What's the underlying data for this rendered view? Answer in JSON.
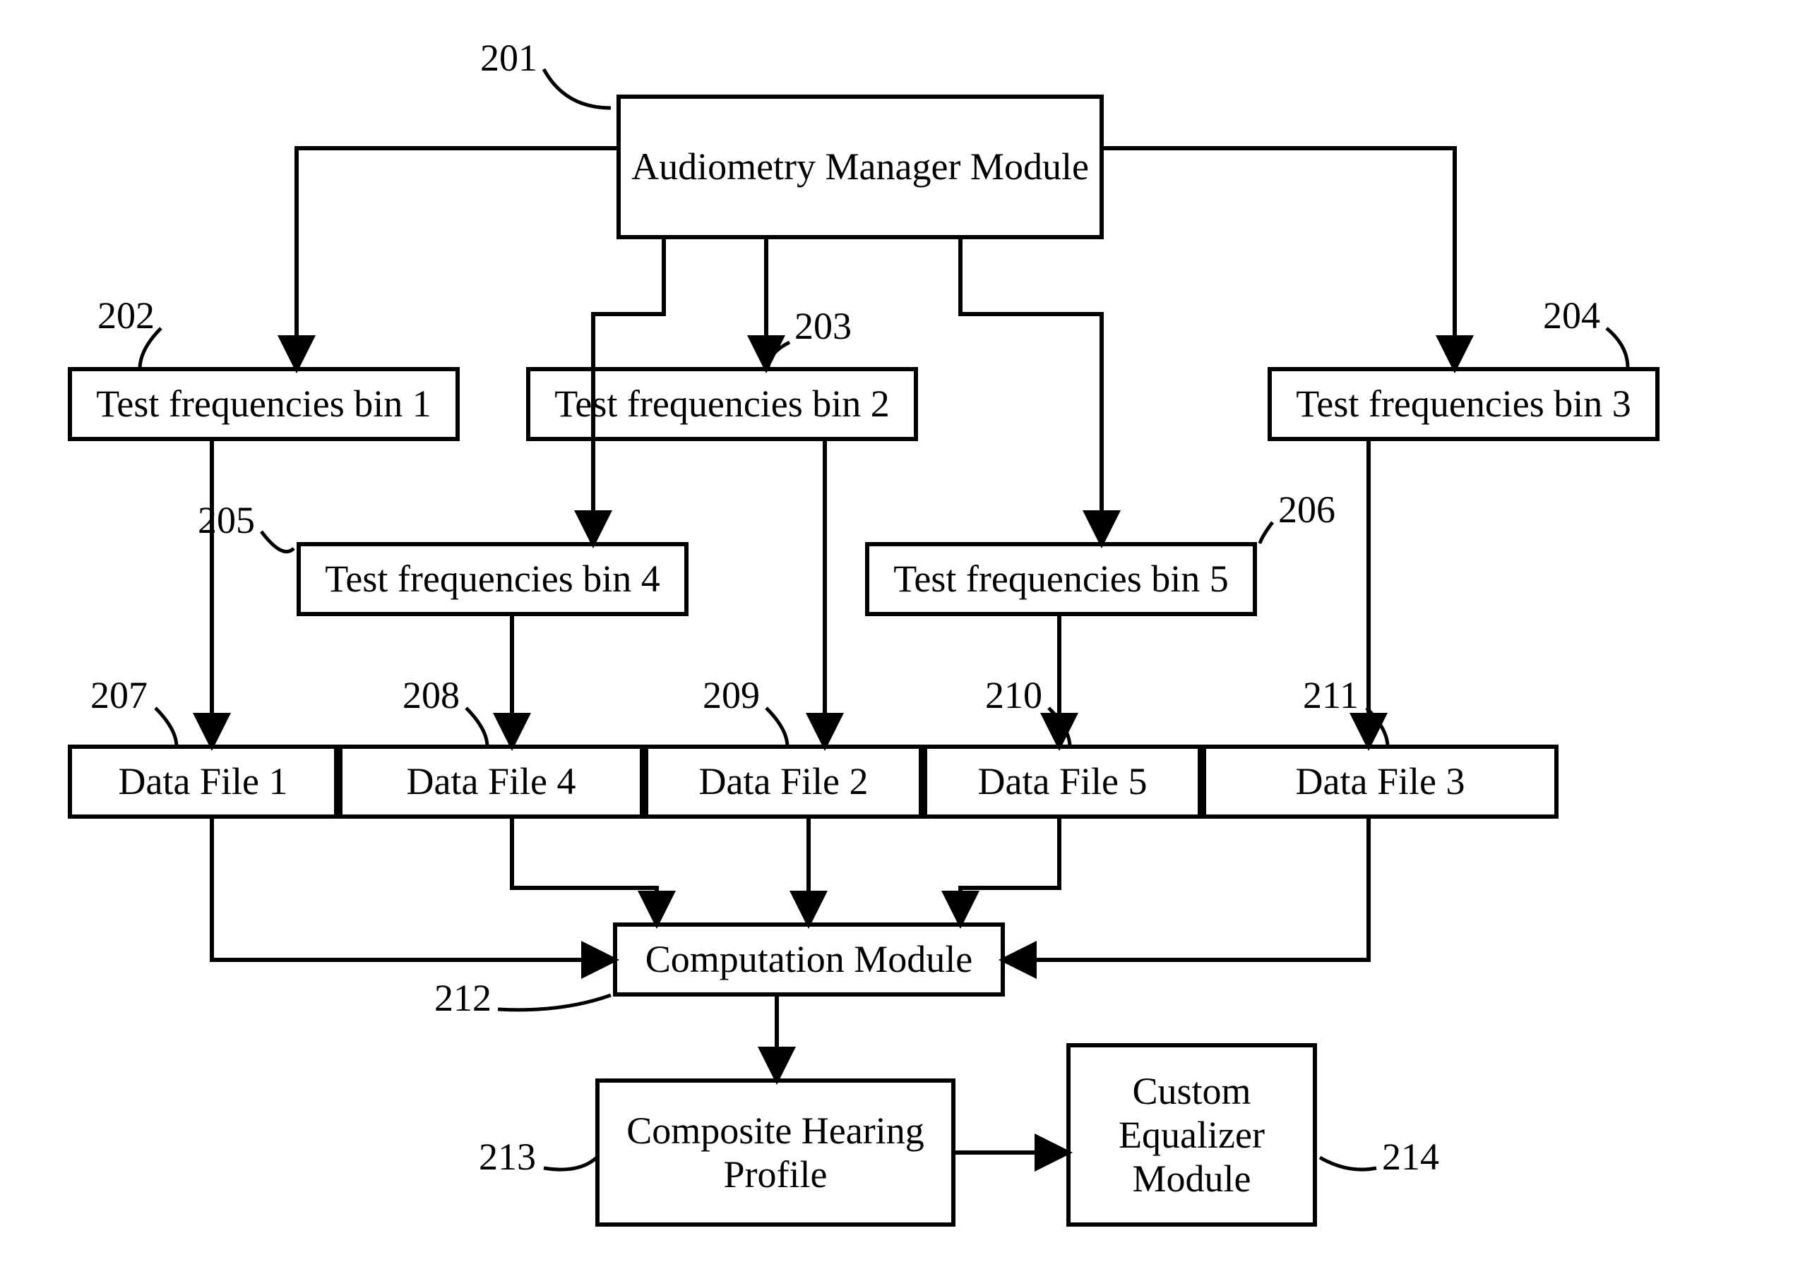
{
  "boxes": {
    "b201": "Audiometry Manager Module",
    "b202": "Test frequencies bin 1",
    "b203": "Test frequencies bin 2",
    "b204": "Test frequencies bin 3",
    "b205": "Test frequencies bin 4",
    "b206": "Test frequencies bin 5",
    "b207": "Data File 1",
    "b208": "Data File 4",
    "b209": "Data File 2",
    "b210": "Data File 5",
    "b211": "Data File 3",
    "b212": "Computation Module",
    "b213": "Composite Hearing Profile",
    "b214": "Custom Equalizer Module"
  },
  "refs": {
    "r201": "201",
    "r202": "202",
    "r203": "203",
    "r204": "204",
    "r205": "205",
    "r206": "206",
    "r207": "207",
    "r208": "208",
    "r209": "209",
    "r210": "210",
    "r211": "211",
    "r212": "212",
    "r213": "213",
    "r214": "214"
  }
}
